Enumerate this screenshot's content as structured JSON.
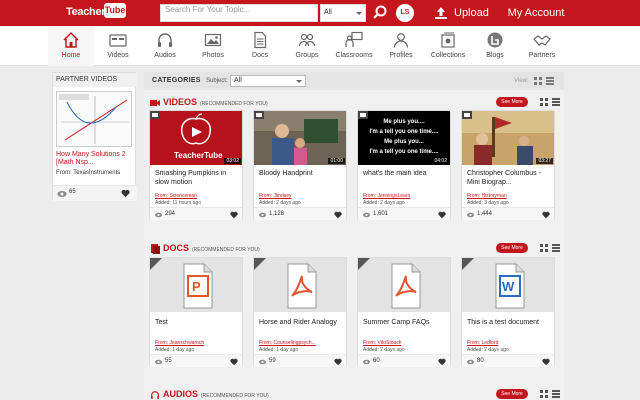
{
  "header": {
    "logo_text_1": "Teacher",
    "logo_text_2": "Tube",
    "search_placeholder": "Search For Your Topic...",
    "search_category": "All",
    "user_badge": "LS",
    "upload_label": "Upload",
    "account_label": "My Account",
    "brand_color": "#c4161c"
  },
  "nav": {
    "items": [
      {
        "label": "Home",
        "icon": "home-icon"
      },
      {
        "label": "Videos",
        "icon": "video-icon"
      },
      {
        "label": "Audios",
        "icon": "headphones-icon"
      },
      {
        "label": "Photos",
        "icon": "photo-icon"
      },
      {
        "label": "Docs",
        "icon": "document-icon"
      },
      {
        "label": "Groups",
        "icon": "groups-icon"
      },
      {
        "label": "Classrooms",
        "icon": "classroom-icon"
      },
      {
        "label": "Profiles",
        "icon": "profile-icon"
      },
      {
        "label": "Collections",
        "icon": "collections-icon"
      },
      {
        "label": "Blogs",
        "icon": "blogs-icon"
      },
      {
        "label": "Partners",
        "icon": "handshake-icon"
      }
    ]
  },
  "partner": {
    "title": "PARTNER VIDEOS",
    "video_title": "How Many Solutions 2 [Math Nsp...",
    "from_label": "From:",
    "from_user": "TexasInstruments",
    "views": "65"
  },
  "categories": {
    "label": "CATEGORIES",
    "subject_label": "Subject:",
    "subject_value": "All",
    "view_label": "View:"
  },
  "videos": {
    "title": "VIDEOS",
    "recommended": "(RECOMMENDED FOR YOU)",
    "see_more": "See More",
    "items": [
      {
        "title": "Smashing Pumpkins in slow motion",
        "from": "Scienceman",
        "added": "Added: 11 hours ago",
        "views": "294",
        "duration": "03:02",
        "thumb_text": "TeacherTube"
      },
      {
        "title": "Bloody Handprint",
        "from": "Jlindsey",
        "added": "Added: 2 days ago",
        "views": "1,128",
        "duration": "01:00"
      },
      {
        "title": "what's the main idea",
        "from": "JenningsLearn",
        "added": "Added: 2 days ago",
        "views": "1,601",
        "duration": "04:02",
        "thumb_lines": [
          "Me plus you....",
          "I'm a tell you one time....",
          "Me plus you...",
          "I'm a tell you one time...."
        ]
      },
      {
        "title": "Christopher Columbus - Mini Biograp...",
        "from": "Historyman",
        "added": "Added: 3 days ago",
        "views": "1,444",
        "duration": "03:27"
      }
    ]
  },
  "docs": {
    "title": "DOCS",
    "recommended": "(RECOMMENDED FOR YOU)",
    "see_more": "See More",
    "items": [
      {
        "title": "Test",
        "from": "Jeanschwaroch",
        "added": "Added: 1 day ago",
        "views": "55",
        "icon_letter": "P",
        "icon_color": "#e2572c"
      },
      {
        "title": "Horse and Rider Analogy",
        "from": "Counselingpsych...",
        "added": "Added: 1 day ago",
        "views": "59",
        "icon_letter": "pdf",
        "icon_color": "#e2572c"
      },
      {
        "title": "Summer Camp FAQs",
        "from": "VitoStouch",
        "added": "Added: 2 days ago",
        "views": "60",
        "icon_letter": "pdf",
        "icon_color": "#e2572c"
      },
      {
        "title": "This is a test document",
        "from": "Ledford",
        "added": "Added: 2 days ago",
        "views": "80",
        "icon_letter": "W",
        "icon_color": "#2a6dbf"
      }
    ]
  },
  "audios": {
    "title": "AUDIOS",
    "recommended": "(RECOMMENDED FOR YOU)",
    "see_more": "See More"
  },
  "common": {
    "from_label": "From:"
  }
}
